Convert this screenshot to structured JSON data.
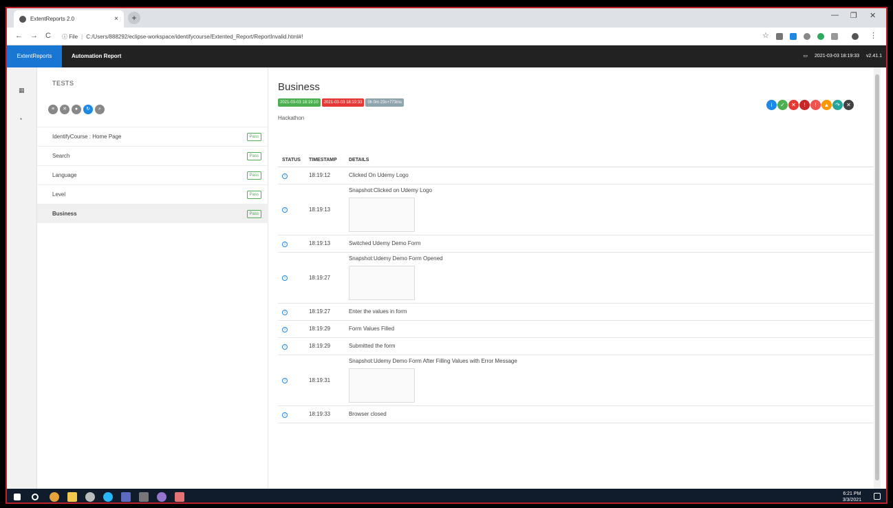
{
  "browser": {
    "tab_title": "ExtentReports 2.0",
    "tab_close": "×",
    "new_tab": "+",
    "back": "←",
    "forward": "→",
    "reload": "C",
    "site_info": "ⓘ File",
    "url": "C:/Users/888292/eclipse-workspace/identifycourse/Extented_Report/ReportInvalid.html#!"
  },
  "report_nav": {
    "brand": "ExtentReports",
    "title": "Automation Report",
    "timestamp": "2021-03-03 18:19:33",
    "version": "v2.41.1"
  },
  "tests_panel": {
    "heading": "TESTS",
    "tests": [
      {
        "name": "IdentifyCourse : Home Page",
        "status": "Pass"
      },
      {
        "name": "Search",
        "status": "Pass"
      },
      {
        "name": "Language",
        "status": "Pass"
      },
      {
        "name": "Level",
        "status": "Pass"
      },
      {
        "name": "Business",
        "status": "Pass"
      }
    ]
  },
  "detail": {
    "title": "Business",
    "start_time": "2021-03-03 18:19:10",
    "end_time": "2021-03-03 18:19:33",
    "duration": "0h 0m 23s+773ms",
    "category": "Hackathon",
    "columns": [
      "STATUS",
      "TIMESTAMP",
      "DETAILS"
    ],
    "logs": [
      {
        "time": "18:19:12",
        "details": "Clicked On Udemy Logo",
        "snapshot": false
      },
      {
        "time": "18:19:13",
        "details": "Snapshot:Clicked on Udemy Logo",
        "snapshot": true
      },
      {
        "time": "18:19:13",
        "details": "Switched Udemy Demo Form",
        "snapshot": false
      },
      {
        "time": "18:19:27",
        "details": "Snapshot:Udemy Demo Form Opened",
        "snapshot": true
      },
      {
        "time": "18:19:27",
        "details": "Enter the values in form",
        "snapshot": false
      },
      {
        "time": "18:19:29",
        "details": "Form Values Filled",
        "snapshot": false
      },
      {
        "time": "18:19:29",
        "details": "Submitted the form",
        "snapshot": false
      },
      {
        "time": "18:19:31",
        "details": "Snapshot:Udemy Demo Form After Filling Values with Error Message",
        "snapshot": true
      },
      {
        "time": "18:19:33",
        "details": "Browser closed",
        "snapshot": false
      }
    ]
  },
  "colors": {
    "pass": "#4caf50",
    "fail": "#e53935",
    "duration": "#90a4ae",
    "brand": "#1976d2",
    "info": "#1e88e5"
  },
  "taskbar": {
    "time": "6:21 PM",
    "date": "3/3/2021"
  }
}
